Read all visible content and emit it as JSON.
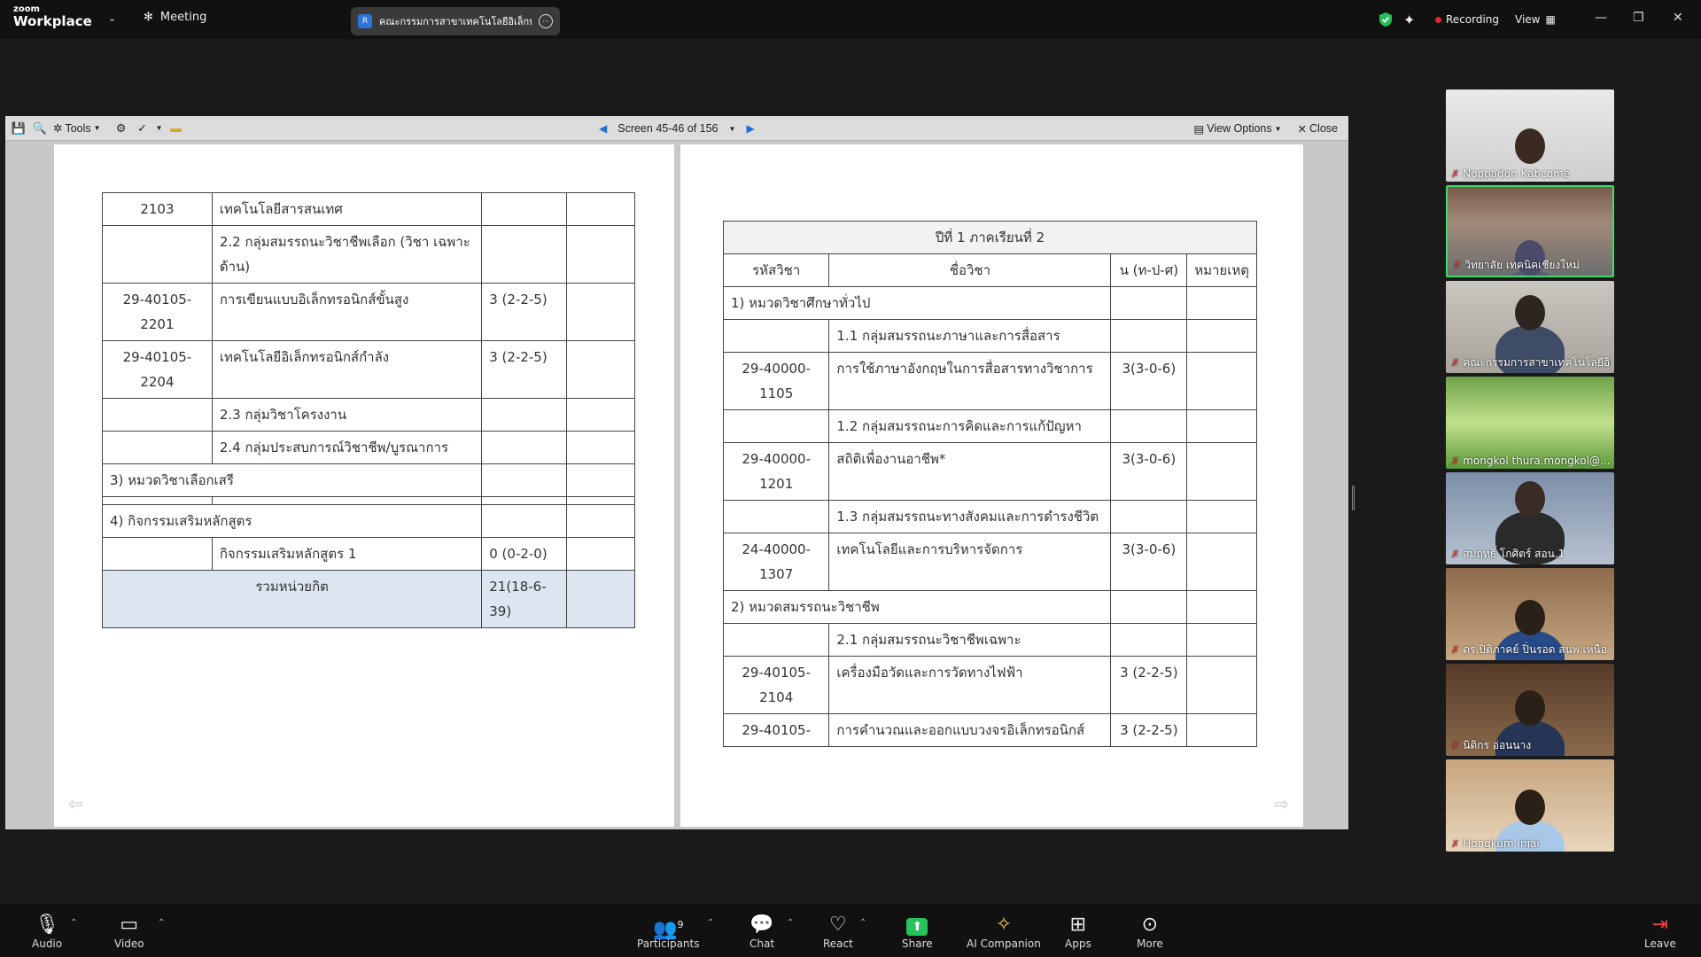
{
  "topbar": {
    "logo_top": "zoom",
    "logo_bottom": "Workplace",
    "meeting_label": "Meeting",
    "share_title": "คณะกรรมการสาขาเทคโนโลยีอิเล็กทรอนิ",
    "share_badge": "R",
    "recording_label": "Recording",
    "view_label": "View"
  },
  "doc_toolbar": {
    "tools_label": "Tools",
    "page_indicator": "Screen 45-46 of 156",
    "view_options_label": "View Options",
    "close_label": "Close"
  },
  "left_table": {
    "rows": [
      [
        "2103",
        "เทคโนโลยีสารสนเทศ",
        "",
        ""
      ],
      [
        "",
        "2.2 กลุ่มสมรรถนะวิชาชีพเลือก (วิชา เฉพาะด้าน)",
        "",
        ""
      ],
      [
        "29-40105-2201",
        "การเขียนแบบอิเล็กทรอนิกส์ขั้นสูง",
        "3 (2-2-5)",
        ""
      ],
      [
        "29-40105-2204",
        "เทคโนโลยีอิเล็กทรอนิกส์กำลัง",
        "3 (2-2-5)",
        ""
      ],
      [
        "",
        "2.3 กลุ่มวิชาโครงงาน",
        "",
        ""
      ],
      [
        "",
        "2.4 กลุ่มประสบการณ์วิชาชีพ/บูรณาการ",
        "",
        ""
      ]
    ],
    "elective_row": "3) หมวดวิชาเลือกเสรี",
    "activity_row": "4) กิจกรรมเสริมหลักสูตร",
    "activity_item": "กิจกรรมเสริมหลักสูตร 1",
    "activity_credit": "0 (0-2-0)",
    "total_label": "รวมหน่วยกิต",
    "total_value": "21(18-6-39)"
  },
  "right_table": {
    "title": "ปีที่ 1 ภาคเรียนที่ 2",
    "headers": [
      "รหัสวิชา",
      "ชื่อวิชา",
      "น (ท-ป-ศ)",
      "หมายเหตุ"
    ],
    "rows": [
      {
        "type": "section",
        "text": "1) หมวดวิชาศึกษาทั่วไป"
      },
      {
        "type": "group",
        "text": "1.1 กลุ่มสมรรถนะภาษาและการสื่อสาร"
      },
      {
        "type": "course",
        "code": "29-40000-1105",
        "name": "การใช้ภาษาอังกฤษในการสื่อสารทางวิชาการ",
        "credit": "3(3-0-6)"
      },
      {
        "type": "group",
        "text": "1.2 กลุ่มสมรรถนะการคิดและการแก้ปัญหา"
      },
      {
        "type": "course",
        "code": "29-40000-1201",
        "name": "สถิติเพื่องานอาชีพ*",
        "credit": "3(3-0-6)"
      },
      {
        "type": "group",
        "text": "1.3 กลุ่มสมรรถนะทางสังคมและการดำรงชีวิต"
      },
      {
        "type": "course",
        "code": "24-40000-1307",
        "name": "เทคโนโลยีและการบริหารจัดการ",
        "credit": "3(3-0-6)"
      },
      {
        "type": "section",
        "text": "2) หมวดสมรรถนะวิชาชีพ"
      },
      {
        "type": "group",
        "text": "2.1 กลุ่มสมรรถนะวิชาชีพเฉพาะ"
      },
      {
        "type": "course",
        "code": "29-40105-2104",
        "name": "เครื่องมือวัดและการวัดทางไฟฟ้า",
        "credit": "3 (2-2-5)"
      },
      {
        "type": "course",
        "code": "29-40105-",
        "name": "การคำนวณและออกแบบวงจรอิเล็กทรอนิกส์",
        "credit": "3 (2-2-5)"
      }
    ]
  },
  "participants": [
    {
      "name": "Noppadon Kabcome"
    },
    {
      "name": "วิทยาลัย เทคนิคเชียงใหม่"
    },
    {
      "name": "คณะกรรมการสาขาเทคโนโลยีอิเล็..."
    },
    {
      "name": "mongkol thura.mongkol@..."
    },
    {
      "name": "สมฤทธิ์ โกศิตร์ สอน.1"
    },
    {
      "name": "ดร.ปิติภาคย์ ปิ่นรอด สนพ.เหนือ"
    },
    {
      "name": "นิติกร อ่อนนาง"
    },
    {
      "name": "Hongkum Injai"
    }
  ],
  "bottombar": {
    "audio": "Audio",
    "video": "Video",
    "participants": "Participants",
    "participants_count": "9",
    "chat": "Chat",
    "react": "React",
    "share": "Share",
    "ai_companion": "AI Companion",
    "apps": "Apps",
    "more": "More",
    "leave": "Leave"
  },
  "colors": {
    "share_green": "#27c25a",
    "recording_red": "#e02828",
    "total_row_fill": "#dce6f1",
    "active_speaker_border": "#3ddc67"
  }
}
